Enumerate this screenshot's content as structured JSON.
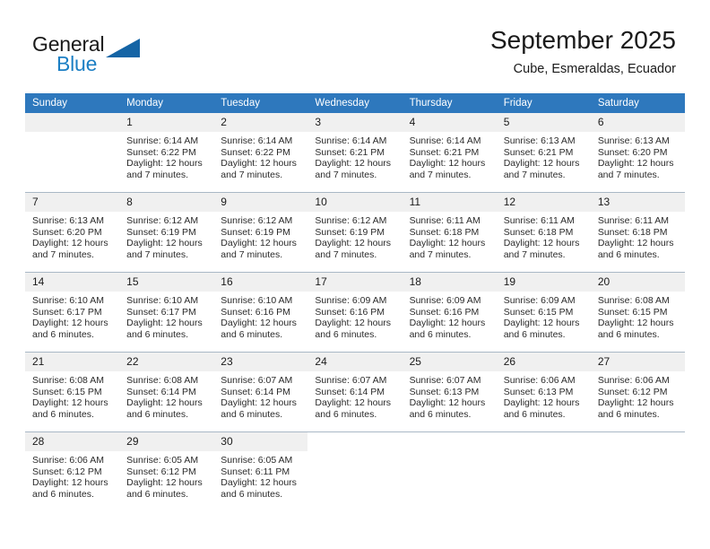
{
  "brand": {
    "name_part1": "General",
    "name_part2": "Blue",
    "accent_color": "#1c7fc4",
    "triangle_color": "#1464a5"
  },
  "header": {
    "month_title": "September 2025",
    "location": "Cube, Esmeraldas, Ecuador"
  },
  "calendar": {
    "header_bg": "#2e78bd",
    "daynum_bg": "#f0f0f0",
    "weekday_headers": [
      "Sunday",
      "Monday",
      "Tuesday",
      "Wednesday",
      "Thursday",
      "Friday",
      "Saturday"
    ],
    "weeks": [
      [
        {
          "day": "",
          "sunrise": "",
          "sunset": "",
          "daylight_line1": "",
          "daylight_line2": "",
          "empty": true
        },
        {
          "day": "1",
          "sunrise": "Sunrise: 6:14 AM",
          "sunset": "Sunset: 6:22 PM",
          "daylight_line1": "Daylight: 12 hours",
          "daylight_line2": "and 7 minutes."
        },
        {
          "day": "2",
          "sunrise": "Sunrise: 6:14 AM",
          "sunset": "Sunset: 6:22 PM",
          "daylight_line1": "Daylight: 12 hours",
          "daylight_line2": "and 7 minutes."
        },
        {
          "day": "3",
          "sunrise": "Sunrise: 6:14 AM",
          "sunset": "Sunset: 6:21 PM",
          "daylight_line1": "Daylight: 12 hours",
          "daylight_line2": "and 7 minutes."
        },
        {
          "day": "4",
          "sunrise": "Sunrise: 6:14 AM",
          "sunset": "Sunset: 6:21 PM",
          "daylight_line1": "Daylight: 12 hours",
          "daylight_line2": "and 7 minutes."
        },
        {
          "day": "5",
          "sunrise": "Sunrise: 6:13 AM",
          "sunset": "Sunset: 6:21 PM",
          "daylight_line1": "Daylight: 12 hours",
          "daylight_line2": "and 7 minutes."
        },
        {
          "day": "6",
          "sunrise": "Sunrise: 6:13 AM",
          "sunset": "Sunset: 6:20 PM",
          "daylight_line1": "Daylight: 12 hours",
          "daylight_line2": "and 7 minutes."
        }
      ],
      [
        {
          "day": "7",
          "sunrise": "Sunrise: 6:13 AM",
          "sunset": "Sunset: 6:20 PM",
          "daylight_line1": "Daylight: 12 hours",
          "daylight_line2": "and 7 minutes."
        },
        {
          "day": "8",
          "sunrise": "Sunrise: 6:12 AM",
          "sunset": "Sunset: 6:19 PM",
          "daylight_line1": "Daylight: 12 hours",
          "daylight_line2": "and 7 minutes."
        },
        {
          "day": "9",
          "sunrise": "Sunrise: 6:12 AM",
          "sunset": "Sunset: 6:19 PM",
          "daylight_line1": "Daylight: 12 hours",
          "daylight_line2": "and 7 minutes."
        },
        {
          "day": "10",
          "sunrise": "Sunrise: 6:12 AM",
          "sunset": "Sunset: 6:19 PM",
          "daylight_line1": "Daylight: 12 hours",
          "daylight_line2": "and 7 minutes."
        },
        {
          "day": "11",
          "sunrise": "Sunrise: 6:11 AM",
          "sunset": "Sunset: 6:18 PM",
          "daylight_line1": "Daylight: 12 hours",
          "daylight_line2": "and 7 minutes."
        },
        {
          "day": "12",
          "sunrise": "Sunrise: 6:11 AM",
          "sunset": "Sunset: 6:18 PM",
          "daylight_line1": "Daylight: 12 hours",
          "daylight_line2": "and 7 minutes."
        },
        {
          "day": "13",
          "sunrise": "Sunrise: 6:11 AM",
          "sunset": "Sunset: 6:18 PM",
          "daylight_line1": "Daylight: 12 hours",
          "daylight_line2": "and 6 minutes."
        }
      ],
      [
        {
          "day": "14",
          "sunrise": "Sunrise: 6:10 AM",
          "sunset": "Sunset: 6:17 PM",
          "daylight_line1": "Daylight: 12 hours",
          "daylight_line2": "and 6 minutes."
        },
        {
          "day": "15",
          "sunrise": "Sunrise: 6:10 AM",
          "sunset": "Sunset: 6:17 PM",
          "daylight_line1": "Daylight: 12 hours",
          "daylight_line2": "and 6 minutes."
        },
        {
          "day": "16",
          "sunrise": "Sunrise: 6:10 AM",
          "sunset": "Sunset: 6:16 PM",
          "daylight_line1": "Daylight: 12 hours",
          "daylight_line2": "and 6 minutes."
        },
        {
          "day": "17",
          "sunrise": "Sunrise: 6:09 AM",
          "sunset": "Sunset: 6:16 PM",
          "daylight_line1": "Daylight: 12 hours",
          "daylight_line2": "and 6 minutes."
        },
        {
          "day": "18",
          "sunrise": "Sunrise: 6:09 AM",
          "sunset": "Sunset: 6:16 PM",
          "daylight_line1": "Daylight: 12 hours",
          "daylight_line2": "and 6 minutes."
        },
        {
          "day": "19",
          "sunrise": "Sunrise: 6:09 AM",
          "sunset": "Sunset: 6:15 PM",
          "daylight_line1": "Daylight: 12 hours",
          "daylight_line2": "and 6 minutes."
        },
        {
          "day": "20",
          "sunrise": "Sunrise: 6:08 AM",
          "sunset": "Sunset: 6:15 PM",
          "daylight_line1": "Daylight: 12 hours",
          "daylight_line2": "and 6 minutes."
        }
      ],
      [
        {
          "day": "21",
          "sunrise": "Sunrise: 6:08 AM",
          "sunset": "Sunset: 6:15 PM",
          "daylight_line1": "Daylight: 12 hours",
          "daylight_line2": "and 6 minutes."
        },
        {
          "day": "22",
          "sunrise": "Sunrise: 6:08 AM",
          "sunset": "Sunset: 6:14 PM",
          "daylight_line1": "Daylight: 12 hours",
          "daylight_line2": "and 6 minutes."
        },
        {
          "day": "23",
          "sunrise": "Sunrise: 6:07 AM",
          "sunset": "Sunset: 6:14 PM",
          "daylight_line1": "Daylight: 12 hours",
          "daylight_line2": "and 6 minutes."
        },
        {
          "day": "24",
          "sunrise": "Sunrise: 6:07 AM",
          "sunset": "Sunset: 6:14 PM",
          "daylight_line1": "Daylight: 12 hours",
          "daylight_line2": "and 6 minutes."
        },
        {
          "day": "25",
          "sunrise": "Sunrise: 6:07 AM",
          "sunset": "Sunset: 6:13 PM",
          "daylight_line1": "Daylight: 12 hours",
          "daylight_line2": "and 6 minutes."
        },
        {
          "day": "26",
          "sunrise": "Sunrise: 6:06 AM",
          "sunset": "Sunset: 6:13 PM",
          "daylight_line1": "Daylight: 12 hours",
          "daylight_line2": "and 6 minutes."
        },
        {
          "day": "27",
          "sunrise": "Sunrise: 6:06 AM",
          "sunset": "Sunset: 6:12 PM",
          "daylight_line1": "Daylight: 12 hours",
          "daylight_line2": "and 6 minutes."
        }
      ],
      [
        {
          "day": "28",
          "sunrise": "Sunrise: 6:06 AM",
          "sunset": "Sunset: 6:12 PM",
          "daylight_line1": "Daylight: 12 hours",
          "daylight_line2": "and 6 minutes."
        },
        {
          "day": "29",
          "sunrise": "Sunrise: 6:05 AM",
          "sunset": "Sunset: 6:12 PM",
          "daylight_line1": "Daylight: 12 hours",
          "daylight_line2": "and 6 minutes."
        },
        {
          "day": "30",
          "sunrise": "Sunrise: 6:05 AM",
          "sunset": "Sunset: 6:11 PM",
          "daylight_line1": "Daylight: 12 hours",
          "daylight_line2": "and 6 minutes."
        },
        {
          "day": "",
          "sunrise": "",
          "sunset": "",
          "daylight_line1": "",
          "daylight_line2": "",
          "blank": true
        },
        {
          "day": "",
          "sunrise": "",
          "sunset": "",
          "daylight_line1": "",
          "daylight_line2": "",
          "blank": true
        },
        {
          "day": "",
          "sunrise": "",
          "sunset": "",
          "daylight_line1": "",
          "daylight_line2": "",
          "blank": true
        },
        {
          "day": "",
          "sunrise": "",
          "sunset": "",
          "daylight_line1": "",
          "daylight_line2": "",
          "blank": true
        }
      ]
    ]
  }
}
